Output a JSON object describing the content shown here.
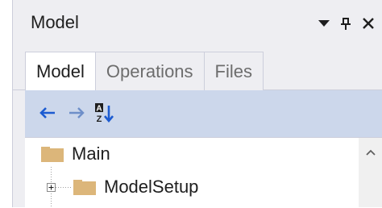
{
  "window": {
    "title": "Model",
    "dropdown_icon": "chevron-down-icon",
    "pin_icon": "pin-icon",
    "close_icon": "close-icon"
  },
  "tabs": [
    {
      "label": "Model",
      "active": true
    },
    {
      "label": "Operations",
      "active": false
    },
    {
      "label": "Files",
      "active": false
    }
  ],
  "toolbar": {
    "back_icon": "arrow-left-icon",
    "forward_icon": "arrow-right-icon",
    "sort_icon": "sort-az-icon"
  },
  "tree": {
    "nodes": [
      {
        "label": "Main",
        "icon": "folder-icon",
        "expandable": false
      },
      {
        "label": "ModelSetup",
        "icon": "folder-icon",
        "expandable": true
      }
    ]
  },
  "colors": {
    "panel_bg": "#eeeef2",
    "toolbar_bg": "#ccd7eb",
    "accent_blue": "#1c5bd1",
    "folder": "#dcb67a"
  }
}
